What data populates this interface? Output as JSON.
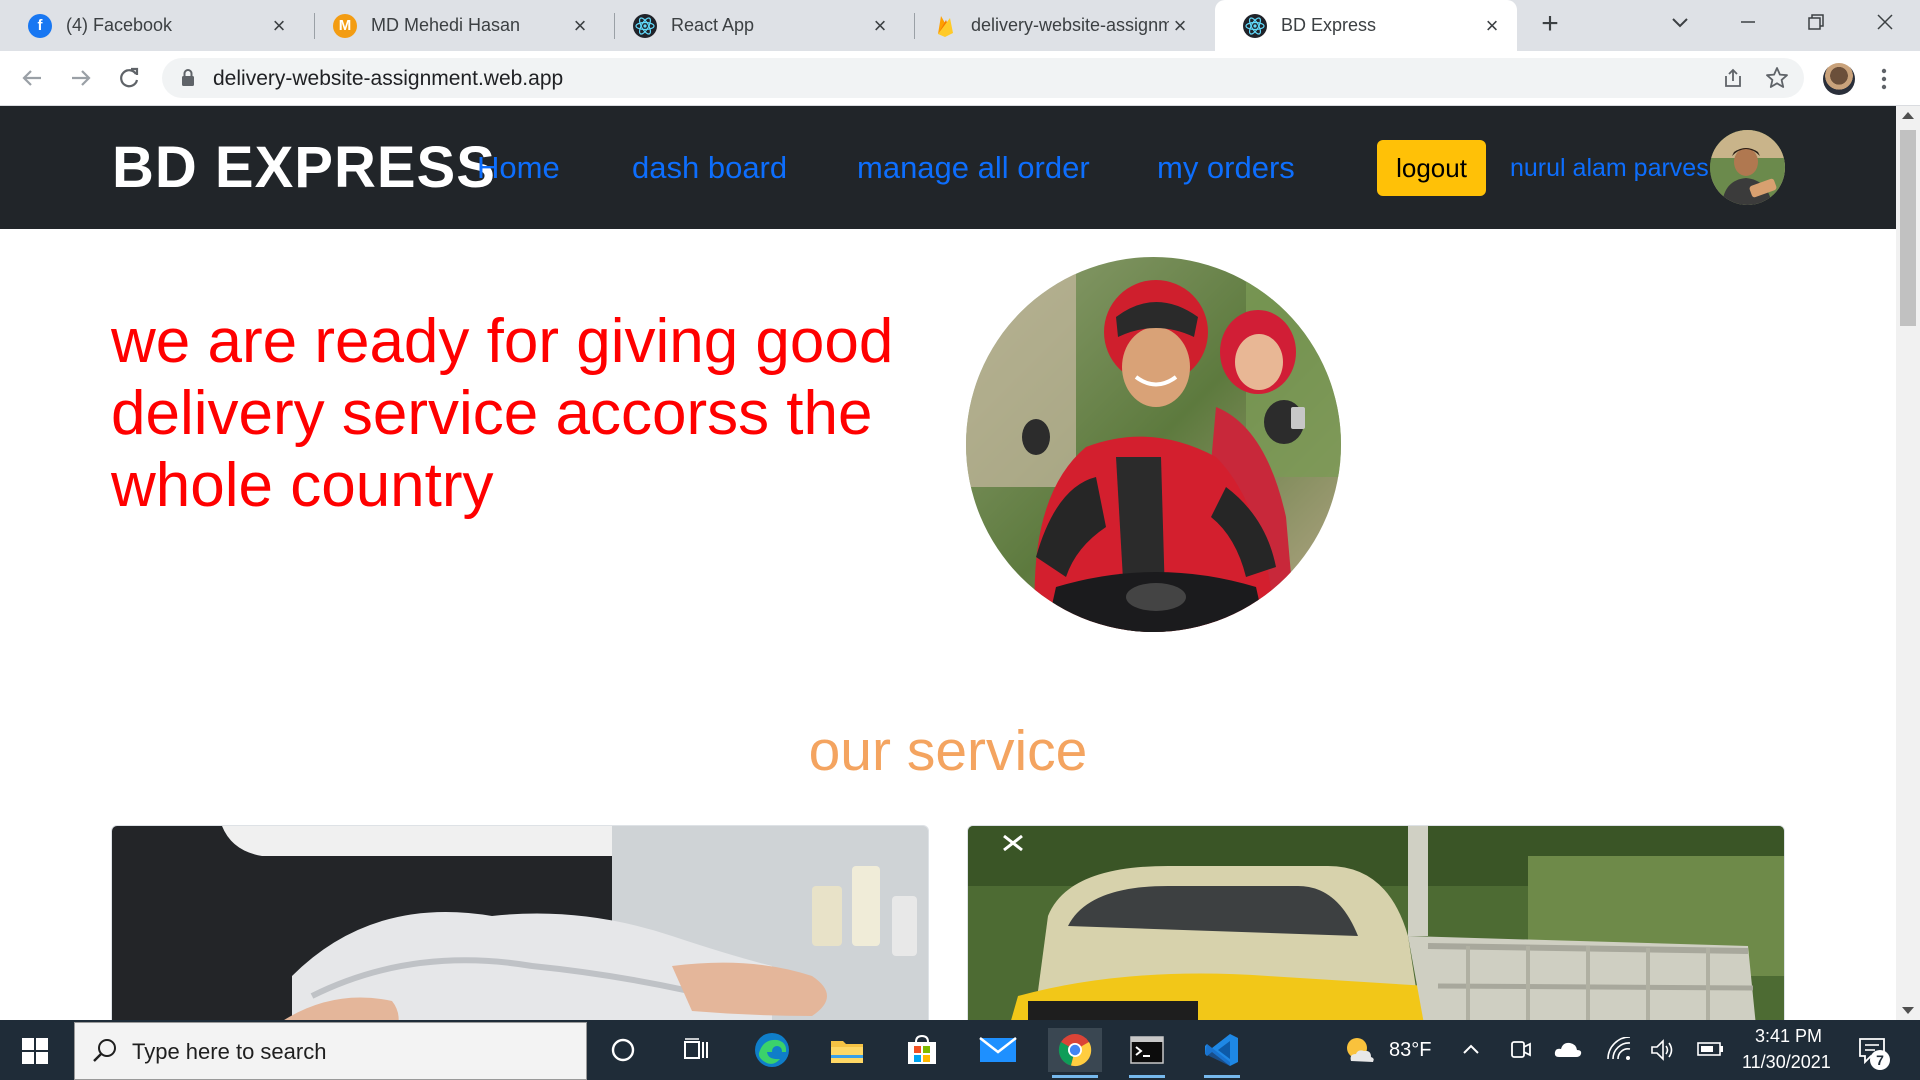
{
  "browser": {
    "tabs": [
      {
        "title": "(4) Facebook",
        "icon": "facebook-icon"
      },
      {
        "title": "MD Mehedi Hasan",
        "icon": "m-logo-icon"
      },
      {
        "title": "React App",
        "icon": "react-icon"
      },
      {
        "title": "delivery-website-assignm",
        "icon": "firebase-icon"
      },
      {
        "title": "BD Express",
        "icon": "react-icon",
        "active": true
      }
    ],
    "url": "delivery-website-assignment.web.app"
  },
  "site": {
    "brand": "BD EXPRESS",
    "nav": {
      "home": "Home",
      "dashboard": "dash board",
      "manage": "manage all order",
      "my_orders": "my orders"
    },
    "logout_label": "logout",
    "user_name": "nurul alam parves",
    "hero_text": "we are ready for giving good delivery service accorss the whole country",
    "section_title": "our service",
    "colors": {
      "navbar": "#212529",
      "link": "#0d6efd",
      "logout": "#ffc107",
      "hero": "#ff0000",
      "section_title": "#f4a460"
    }
  },
  "taskbar": {
    "search_placeholder": "Type here to search",
    "weather": "83°F",
    "time": "3:41 PM",
    "date": "11/30/2021",
    "notifications": "7"
  }
}
